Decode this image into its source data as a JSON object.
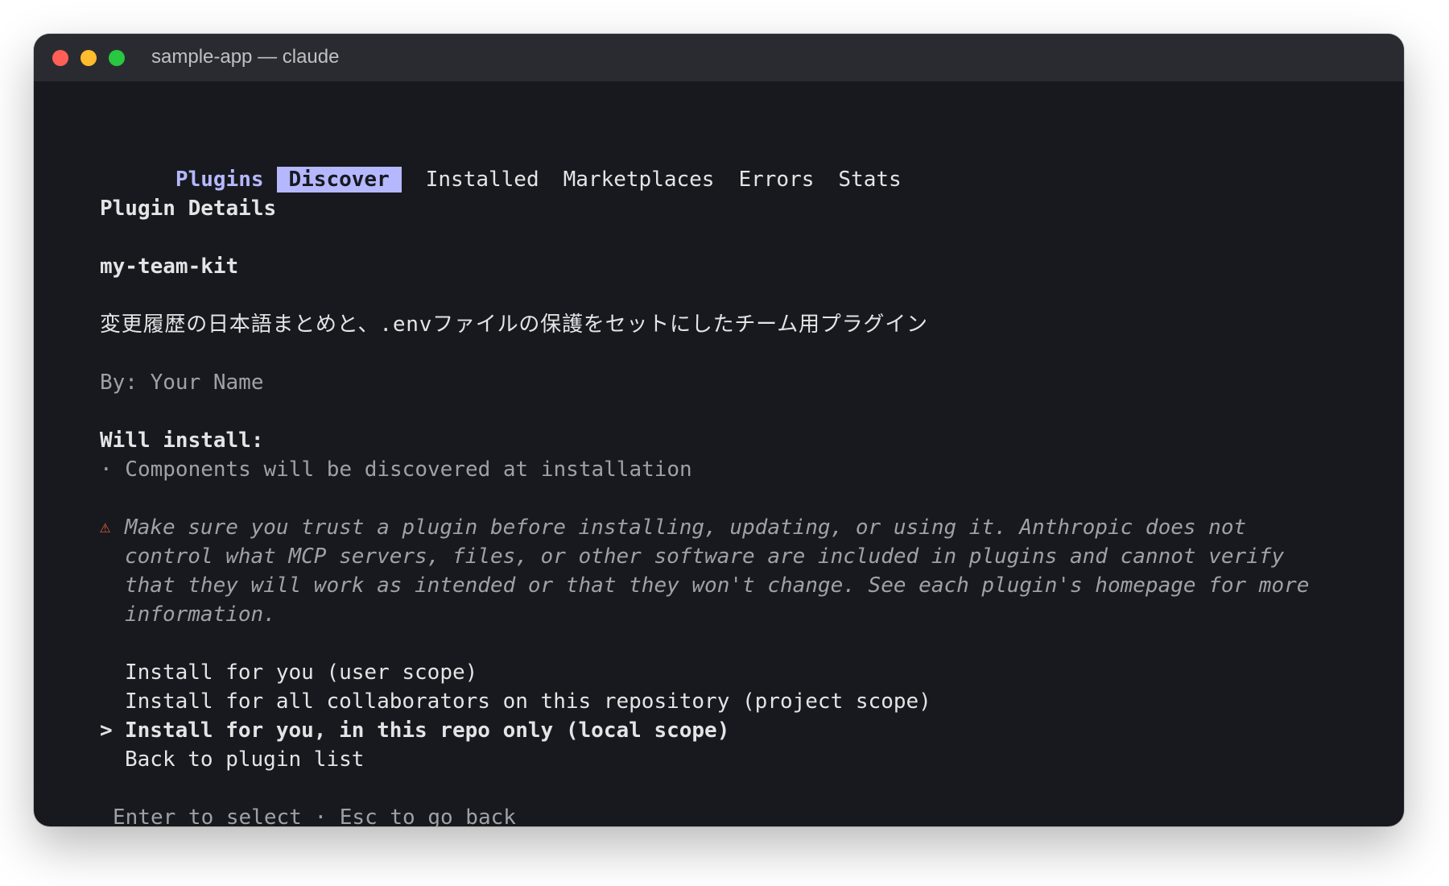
{
  "window": {
    "title": "sample-app — claude"
  },
  "tabs": {
    "label": "Plugins",
    "selected": "Discover",
    "items": [
      "Installed",
      "Marketplaces",
      "Errors",
      "Stats"
    ]
  },
  "details": {
    "heading": "Plugin Details",
    "name": "my-team-kit",
    "description": "変更履歴の日本語まとめと、.envファイルの保護をセットにしたチーム用プラグイン",
    "author": "By: Your Name",
    "will_install_label": "Will install:",
    "components": "· Components will be discovered at installation"
  },
  "warning": {
    "icon": "warning-icon",
    "symbol": "⚠",
    "lines": [
      "Make sure you trust a plugin before installing, updating, or using it. Anthropic does not",
      "control what MCP servers, files, or other software are included in plugins and cannot verify",
      "that they will work as intended or that they won't change. See each plugin's homepage for more",
      "information."
    ]
  },
  "options": {
    "pointer": ">",
    "selected_index": 2,
    "items": [
      "Install for you (user scope)",
      "Install for all collaborators on this repository (project scope)",
      "Install for you, in this repo only (local scope)",
      "Back to plugin list"
    ]
  },
  "footer": {
    "hint": "Enter to select · Esc to go back"
  },
  "colors": {
    "background": "#18191e",
    "accent": "#b5b8ff",
    "warning": "#e8633f",
    "muted": "#a0a1a6"
  }
}
